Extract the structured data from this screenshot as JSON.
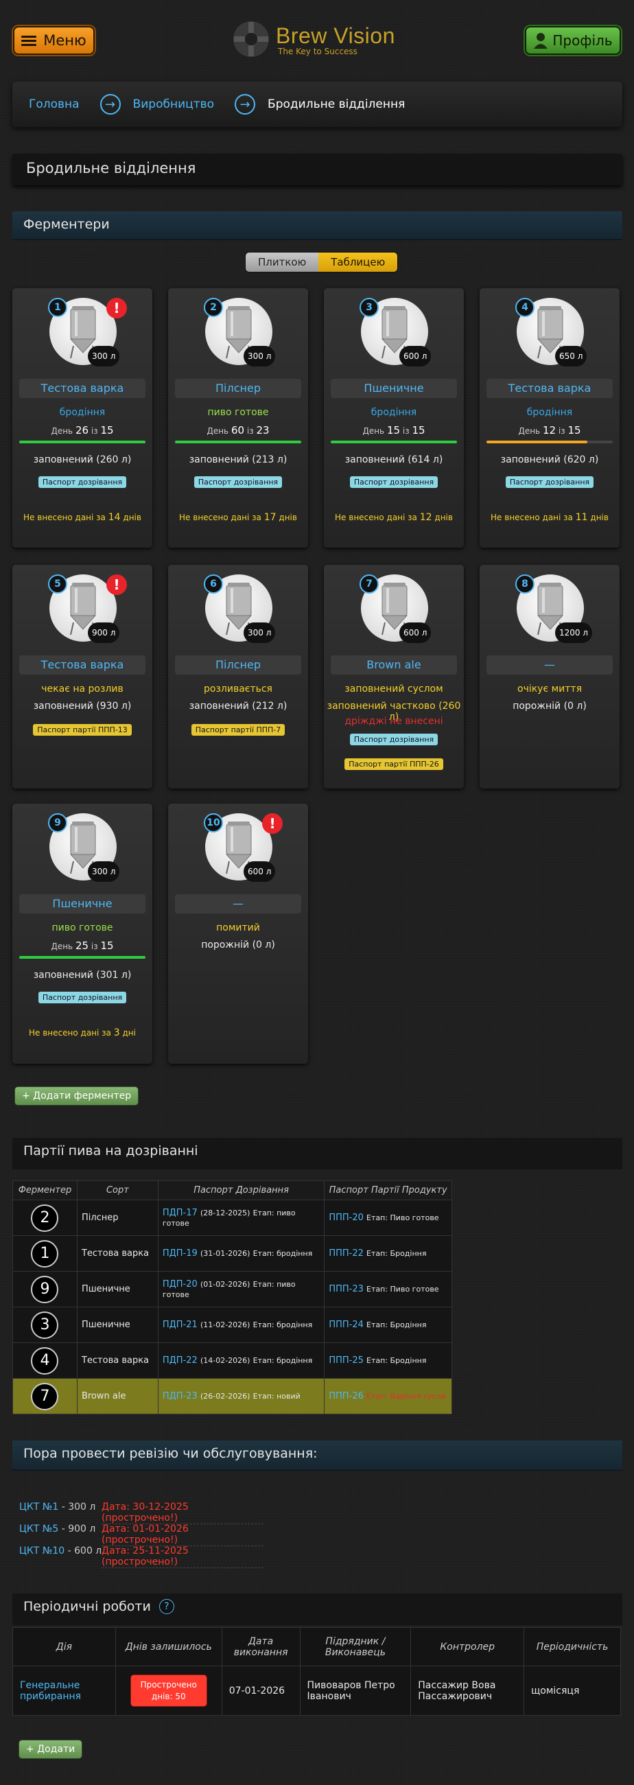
{
  "header": {
    "menu_label": "Меню",
    "logo_title": "Brew Vision",
    "logo_subtitle": "The Key to Success",
    "profile_label": "Профіль"
  },
  "breadcrumb": {
    "items": [
      "Головна",
      "Виробництво",
      "Бродильне відділення"
    ]
  },
  "page_title": "Бродильне відділення",
  "fermenters_section": {
    "title": "Ферментери",
    "view_toggle": [
      "Плиткою",
      "Таблицею"
    ],
    "add_button": "+ Додати ферментер",
    "cards": [
      {
        "num": "1",
        "capacity": "300 л",
        "alert": "!",
        "name": "Тестова варка",
        "status": "бродіння",
        "day_label": "День",
        "day": "26",
        "of_label": "із",
        "total": "15",
        "progress": 1.0,
        "progress_color": "#2ecc40",
        "fill": "заповнений (260 л)",
        "passport": "Паспорт дозрівання",
        "note_pre": "Не внесено дані за",
        "note_days": "14",
        "note_post": "днів"
      },
      {
        "num": "2",
        "capacity": "300 л",
        "name": "Пілснер",
        "status": "пиво готове",
        "day_label": "День",
        "day": "60",
        "of_label": "із",
        "total": "23",
        "progress": 1.0,
        "progress_color": "#2ecc40",
        "fill": "заповнений (213 л)",
        "passport": "Паспорт дозрівання",
        "note_pre": "Не внесено дані за",
        "note_days": "17",
        "note_post": "днів"
      },
      {
        "num": "3",
        "capacity": "600 л",
        "name": "Пшеничне",
        "status": "бродіння",
        "day_label": "День",
        "day": "15",
        "of_label": "із",
        "total": "15",
        "progress": 1.0,
        "progress_color": "#2ecc40",
        "fill": "заповнений (614 л)",
        "passport": "Паспорт дозрівання",
        "note_pre": "Не внесено дані за",
        "note_days": "12",
        "note_post": "днів"
      },
      {
        "num": "4",
        "capacity": "650 л",
        "name": "Тестова варка",
        "status": "бродіння",
        "day_label": "День",
        "day": "12",
        "of_label": "із",
        "total": "15",
        "progress": 0.8,
        "progress_color": "#f5a623",
        "fill": "заповнений (620 л)",
        "passport": "Паспорт дозрівання",
        "note_pre": "Не внесено дані за",
        "note_days": "11",
        "note_post": "днів"
      },
      {
        "num": "5",
        "capacity": "900 л",
        "alert": "!",
        "name": "Тестова варка",
        "status": "чекає на розлив",
        "fill": "заповнений (930 л)",
        "batch_passport": "Паспорт партії ППП-13"
      },
      {
        "num": "6",
        "capacity": "300 л",
        "name": "Пілснер",
        "status": "розливається",
        "fill": "заповнений (212 л)",
        "batch_passport": "Паспорт партії ППП-7"
      },
      {
        "num": "7",
        "capacity": "600 л",
        "name": "Brown ale",
        "status": "заповнений суслом",
        "fill_yellow": "заповнений частково (260 л)",
        "warning": "дріжджі не внесені",
        "passport": "Паспорт дозрівання",
        "batch_passport": "Паспорт партії ППП-26"
      },
      {
        "num": "8",
        "capacity": "1200 л",
        "name": "—",
        "status": "очікує миття",
        "fill": "порожній (0 л)"
      },
      {
        "num": "9",
        "capacity": "300 л",
        "name": "Пшеничне",
        "status": "пиво готове",
        "day_label": "День",
        "day": "25",
        "of_label": "із",
        "total": "15",
        "progress": 1.0,
        "progress_color": "#2ecc40",
        "fill": "заповнений (301 л)",
        "passport": "Паспорт дозрівання",
        "note_pre": "Не внесено дані за",
        "note_days": "3",
        "note_post": "дні"
      },
      {
        "num": "10",
        "capacity": "600 л",
        "alert": "!",
        "name": "—",
        "status": "помитий",
        "fill": "порожній (0 л)"
      }
    ]
  },
  "batches_section": {
    "title": "Партії пива на дозріванні",
    "columns": [
      "Ферментер",
      "Сорт",
      "Паспорт Дозрівання",
      "Паспорт Партії Продукту"
    ],
    "rows": [
      {
        "fermenter": "2",
        "sort": "Пілснер",
        "mp_link": "ПДП-17",
        "mp_date": "(28-12-2025)",
        "mp_stage": "Етап: пиво готове",
        "pp_link": "ППП-20",
        "pp_stage": "Етап: Пиво готове"
      },
      {
        "fermenter": "1",
        "sort": "Тестова варка",
        "mp_link": "ПДП-19",
        "mp_date": "(31-01-2026)",
        "mp_stage": "Етап: бродіння",
        "pp_link": "ППП-22",
        "pp_stage": "Етап: Бродіння"
      },
      {
        "fermenter": "9",
        "sort": "Пшеничне",
        "mp_link": "ПДП-20",
        "mp_date": "(01-02-2026)",
        "mp_stage": "Етап: пиво готове",
        "pp_link": "ППП-23",
        "pp_stage": "Етап: Пиво готове"
      },
      {
        "fermenter": "3",
        "sort": "Пшеничне",
        "mp_link": "ПДП-21",
        "mp_date": "(11-02-2026)",
        "mp_stage": "Етап: бродіння",
        "pp_link": "ППП-24",
        "pp_stage": "Етап: Бродіння"
      },
      {
        "fermenter": "4",
        "sort": "Тестова варка",
        "mp_link": "ПДП-22",
        "mp_date": "(14-02-2026)",
        "mp_stage": "Етап: бродіння",
        "pp_link": "ППП-25",
        "pp_stage": "Етап: Бродіння"
      },
      {
        "fermenter": "7",
        "sort": "Brown ale",
        "mp_link": "ПДП-23",
        "mp_date": "(26-02-2026)",
        "mp_stage": "Етап: новий",
        "pp_link": "ППП-26",
        "pp_stage": "Етап: Варіння сусла",
        "highlight": true
      }
    ]
  },
  "revision_section": {
    "title": "Пора провести ревізію чи обслуговування:",
    "items": [
      {
        "link": "ЦКТ №1",
        "volume": " - 300 л",
        "date": "Дата: 30-12-2025 (прострочено!)"
      },
      {
        "link": "ЦКТ №5",
        "volume": " - 900 л",
        "date": "Дата: 01-01-2026 (прострочено!)"
      },
      {
        "link": "ЦКТ №10",
        "volume": " - 600 л",
        "date": "Дата: 25-11-2025 (прострочено!)"
      }
    ]
  },
  "periodic_section": {
    "title": "Періодичні роботи",
    "help": "?",
    "columns": [
      "Дія",
      "Днів залишилось",
      "Дата виконання",
      "Підрядник / Виконавець",
      "Контролер",
      "Періодичність"
    ],
    "rows": [
      {
        "action": "Генеральне прибирання",
        "overdue_line1": "Прострочено",
        "overdue_line2": "днів: 50",
        "date": "07-01-2026",
        "contractor": "Пивоваров Петро Іванович",
        "controller": "Пассажир Вова Пассажирович",
        "periodicity": "щомісяця"
      }
    ],
    "add_button": "+ Додати"
  }
}
